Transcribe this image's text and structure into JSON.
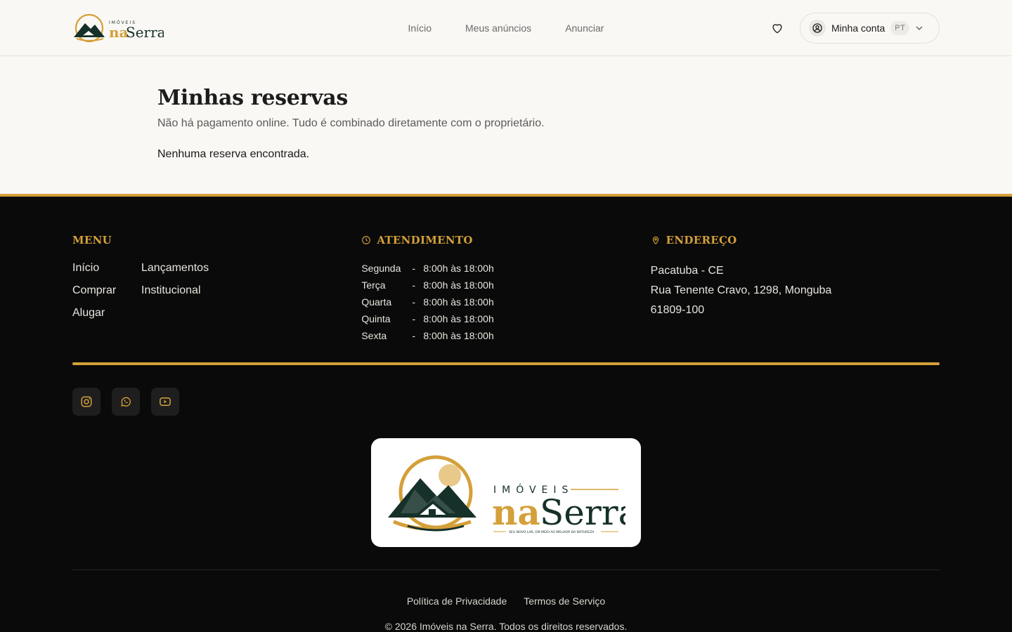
{
  "brand": {
    "small_word": "IMÓVEIS",
    "word_part1": "na",
    "word_part2": "Serra",
    "tagline": "SEU NOVO LAR, EM MEIO AO MELHOR DA NATUREZA",
    "colors": {
      "gold": "#d4a03a",
      "dark_green": "#16302a"
    }
  },
  "nav": {
    "links": [
      "Início",
      "Meus anúncios",
      "Anunciar"
    ]
  },
  "header": {
    "favorites_icon": "heart-icon",
    "account_label": "Minha conta",
    "language": "PT"
  },
  "main": {
    "title": "Minhas reservas",
    "subtitle": "Não há pagamento online. Tudo é combinado diretamente com o proprietário.",
    "empty_message": "Nenhuma reserva encontrada."
  },
  "footer": {
    "menu": {
      "title": "MENU",
      "items": [
        "Início",
        "Lançamentos",
        "Comprar",
        "Institucional",
        "Alugar"
      ]
    },
    "hours": {
      "title": "ATENDIMENTO",
      "rows": [
        {
          "day": "Segunda",
          "sep": "-",
          "time": "8:00h às 18:00h"
        },
        {
          "day": "Terça",
          "sep": "-",
          "time": "8:00h às 18:00h"
        },
        {
          "day": "Quarta",
          "sep": "-",
          "time": "8:00h às 18:00h"
        },
        {
          "day": "Quinta",
          "sep": "-",
          "time": "8:00h às 18:00h"
        },
        {
          "day": "Sexta",
          "sep": "-",
          "time": "8:00h às 18:00h"
        }
      ]
    },
    "address": {
      "title": "ENDEREÇO",
      "lines": [
        "Pacatuba - CE",
        "Rua Tenente Cravo, 1298, Monguba",
        "61809-100"
      ]
    },
    "socials": [
      "instagram-icon",
      "whatsapp-icon",
      "youtube-icon"
    ],
    "legal": [
      "Política de Privacidade",
      "Termos de Serviço"
    ],
    "copyright": "© 2026 Imóveis na Serra. Todos os direitos reservados."
  }
}
